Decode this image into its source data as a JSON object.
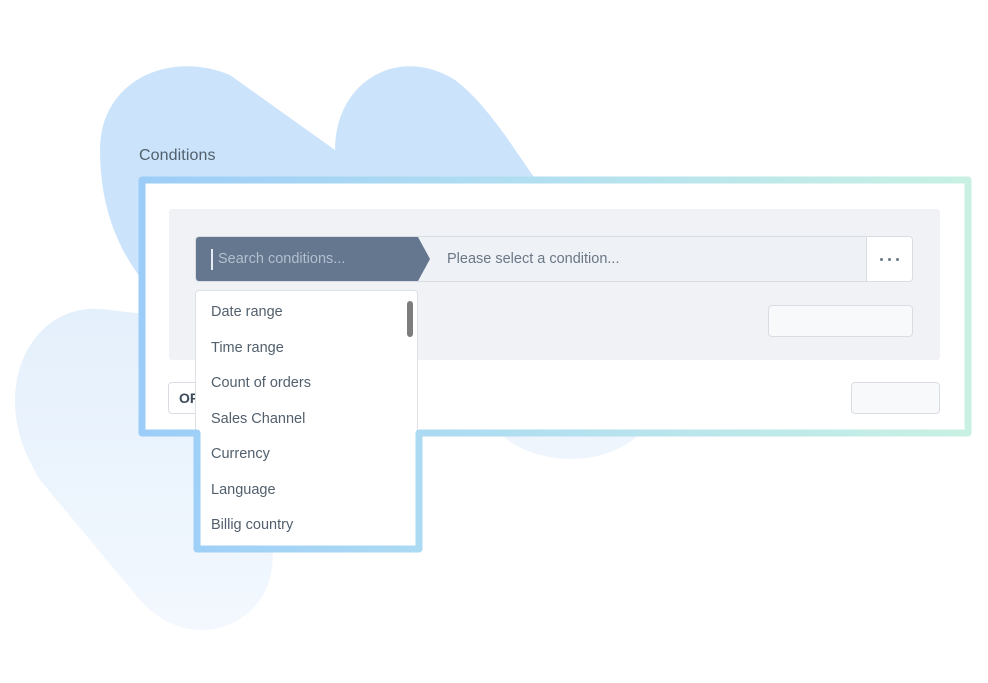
{
  "section": {
    "title": "Conditions"
  },
  "condition_editor": {
    "search_placeholder": "Search conditions...",
    "condition_placeholder": "Please select a condition...",
    "more_button_icon": "ellipsis-horizontal-icon",
    "or_button_label": "OR"
  },
  "dropdown": {
    "items": [
      {
        "label": "Date range"
      },
      {
        "label": "Time range"
      },
      {
        "label": "Count of orders"
      },
      {
        "label": "Sales Channel"
      },
      {
        "label": "Currency"
      },
      {
        "label": "Language"
      },
      {
        "label": "Billig country"
      }
    ]
  },
  "colors": {
    "search_segment": "#64778f",
    "frame_gradient_start": "#9ccdf7",
    "frame_gradient_end": "#c8f0e4",
    "blob_top": "#cce3fa",
    "blob_bottom": "#eef5fd"
  }
}
